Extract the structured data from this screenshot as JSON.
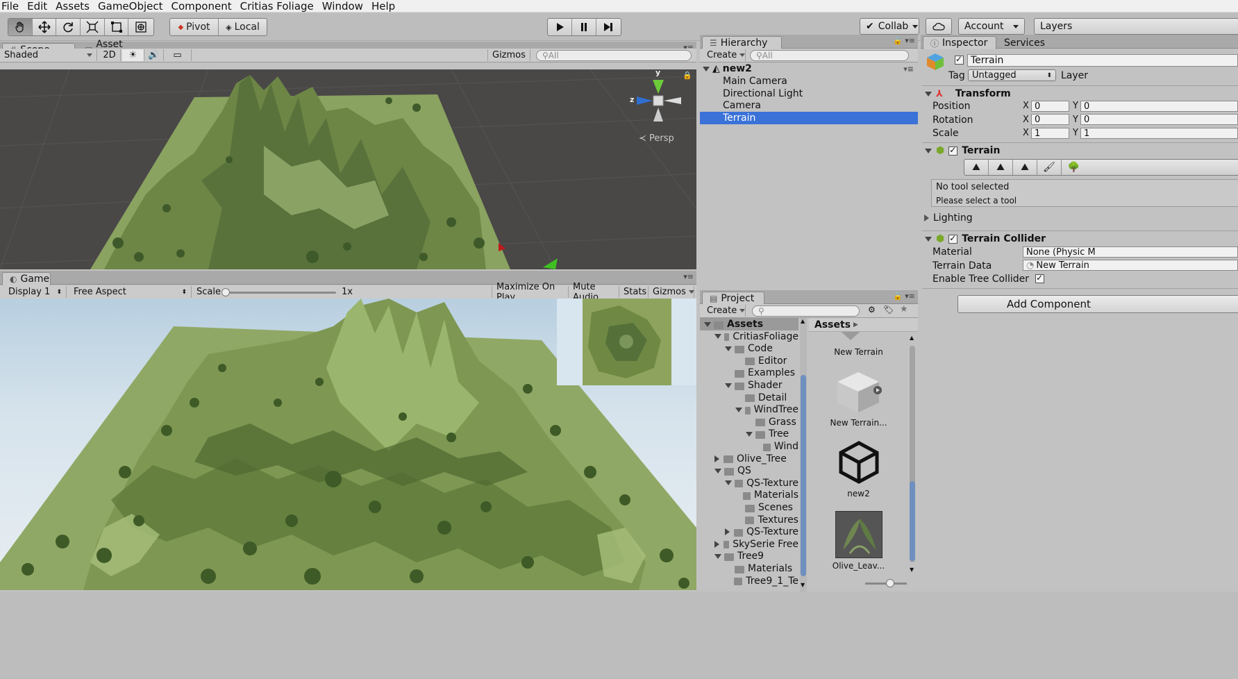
{
  "menu": [
    "File",
    "Edit",
    "Assets",
    "GameObject",
    "Component",
    "Critias Foliage",
    "Window",
    "Help"
  ],
  "toolbar": {
    "tools": [
      "hand-icon",
      "move-icon",
      "rotate-icon",
      "scale-icon",
      "rect-icon",
      "transform-icon"
    ],
    "pivot": "Pivot",
    "local": "Local",
    "collab": "Collab",
    "account": "Account",
    "layers": "Layers"
  },
  "scene": {
    "tab": "Scene",
    "asset_store_tab": "Asset Store",
    "shading": "Shaded",
    "mode2d": "2D",
    "gizmos": "Gizmos",
    "search_placeholder": "All",
    "persp": "Persp",
    "axis_y": "y",
    "axis_z": "z"
  },
  "game": {
    "tab": "Game",
    "display": "Display 1",
    "aspect": "Free Aspect",
    "scale_label": "Scale",
    "scale_value": "1x",
    "maximize": "Maximize On Play",
    "mute": "Mute Audio",
    "stats": "Stats",
    "gizmos": "Gizmos"
  },
  "hierarchy": {
    "tab": "Hierarchy",
    "create": "Create",
    "search_placeholder": "All",
    "scene_name": "new2",
    "items": [
      "Main Camera",
      "Directional Light",
      "Camera",
      "Terrain"
    ],
    "selected": "Terrain"
  },
  "project": {
    "tab": "Project",
    "create": "Create",
    "root": "Assets",
    "tree": [
      {
        "label": "Assets",
        "depth": 0,
        "expanded": true,
        "bold": true
      },
      {
        "label": "CritiasFoliage",
        "depth": 1,
        "expanded": true
      },
      {
        "label": "Code",
        "depth": 2,
        "expanded": true
      },
      {
        "label": "Editor",
        "depth": 3,
        "expanded": null
      },
      {
        "label": "Examples",
        "depth": 2,
        "expanded": null
      },
      {
        "label": "Shader",
        "depth": 2,
        "expanded": true
      },
      {
        "label": "Detail",
        "depth": 3,
        "expanded": null
      },
      {
        "label": "WindTree",
        "depth": 3,
        "expanded": true
      },
      {
        "label": "Grass",
        "depth": 4,
        "expanded": null
      },
      {
        "label": "Tree",
        "depth": 4,
        "expanded": true
      },
      {
        "label": "Wind",
        "depth": 5,
        "expanded": null
      },
      {
        "label": "Olive_Tree",
        "depth": 1,
        "expanded": false
      },
      {
        "label": "QS",
        "depth": 1,
        "expanded": true
      },
      {
        "label": "QS-Texture",
        "depth": 2,
        "expanded": true
      },
      {
        "label": "Materials",
        "depth": 3,
        "expanded": null
      },
      {
        "label": "Scenes",
        "depth": 3,
        "expanded": null
      },
      {
        "label": "Textures",
        "depth": 3,
        "expanded": null
      },
      {
        "label": "QS-Texture",
        "depth": 2,
        "expanded": false
      },
      {
        "label": "SkySerie Free",
        "depth": 1,
        "expanded": false
      },
      {
        "label": "Tree9",
        "depth": 1,
        "expanded": true
      },
      {
        "label": "Materials",
        "depth": 2,
        "expanded": null
      },
      {
        "label": "Tree9_1_Te",
        "depth": 2,
        "expanded": null
      }
    ],
    "breadcrumb": "Assets",
    "assets": [
      "New Terrain",
      "New Terrain...",
      "new2",
      "Olive_Leav..."
    ]
  },
  "inspector": {
    "tab": "Inspector",
    "services_tab": "Services",
    "object_name": "Terrain",
    "tag_label": "Tag",
    "tag_value": "Untagged",
    "layer_label": "Layer",
    "transform": {
      "title": "Transform",
      "position_label": "Position",
      "rotation_label": "Rotation",
      "scale_label": "Scale",
      "x_label": "X",
      "y_label": "Y",
      "position_x": "0",
      "position_y": "0",
      "rotation_x": "0",
      "rotation_y": "0",
      "scale_x": "1",
      "scale_y": "1"
    },
    "terrain": {
      "title": "Terrain",
      "no_tool": "No tool selected",
      "select_tool": "Please select a tool",
      "lighting": "Lighting"
    },
    "collider": {
      "title": "Terrain Collider",
      "material_label": "Material",
      "material_value": "None (Physic M",
      "data_label": "Terrain Data",
      "data_value": "New Terrain",
      "tree_label": "Enable Tree Collider"
    },
    "add_component": "Add Component"
  },
  "colors": {
    "selection": "#3a72d8",
    "terrain_green": "#7f9a55",
    "scene_bg": "#4a4747"
  }
}
